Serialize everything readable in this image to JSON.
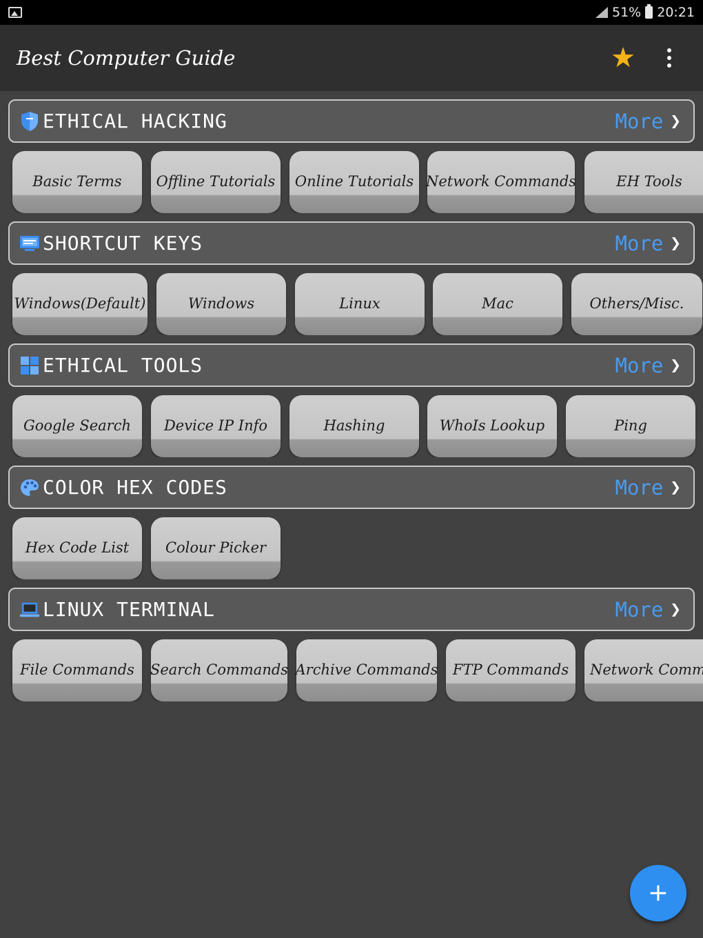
{
  "status_bar": {
    "icons": [
      "image-icon",
      "signal-icon",
      "battery-icon"
    ],
    "battery": "51%",
    "time": "20:21"
  },
  "app_bar": {
    "title": "Best Computer Guide",
    "icons": [
      "star-icon",
      "overflow-menu-icon"
    ]
  },
  "sections": [
    {
      "title": "ETHICAL HACKING",
      "icon": "shield-icon",
      "more_label": "More",
      "items": [
        "Basic Terms",
        "Offline Tutorials",
        "Online Tutorials",
        "Network Commands",
        "EH Tools"
      ]
    },
    {
      "title": "SHORTCUT KEYS",
      "icon": "keyboard-icon",
      "more_label": "More",
      "items": [
        "Windows(Default)",
        "Windows",
        "Linux",
        "Mac",
        "Others/Misc."
      ]
    },
    {
      "title": "ETHICAL TOOLS",
      "icon": "dashboard-icon",
      "more_label": "More",
      "items": [
        "Google Search",
        "Device IP Info",
        "Hashing",
        "WhoIs Lookup",
        "Ping"
      ]
    },
    {
      "title": "COLOR HEX CODES",
      "icon": "palette-icon",
      "more_label": "More",
      "items": [
        "Hex Code List",
        "Colour Picker"
      ]
    },
    {
      "title": "LINUX TERMINAL",
      "icon": "laptop-icon",
      "more_label": "More",
      "items": [
        "File Commands",
        "Search Commands",
        "Archive Commands",
        "FTP Commands",
        "Network Comm"
      ]
    }
  ],
  "fab": {
    "icon": "plus-icon"
  },
  "colors": {
    "background": "#414141",
    "app_bar": "#2f2f2f",
    "accent": "#4a9bf0",
    "fab": "#2e8ff0",
    "star": "#f5b31a"
  }
}
